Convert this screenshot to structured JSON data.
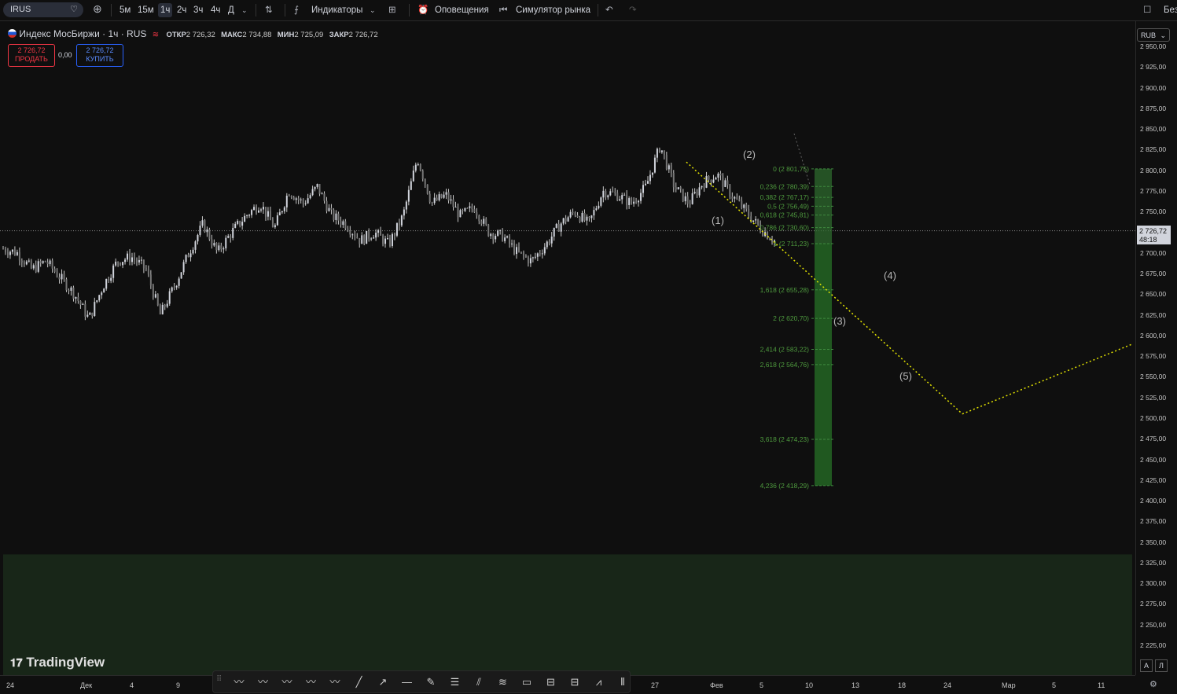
{
  "toolbar": {
    "symbol": "IRUS",
    "intervals": [
      "5м",
      "15м",
      "1ч",
      "2ч",
      "3ч",
      "4ч",
      "Д"
    ],
    "active_interval": "1ч",
    "indicators_label": "Индикаторы",
    "alerts_label": "Оповещения",
    "replay_label": "Симулятор рынка",
    "right_label": "Без"
  },
  "legend": {
    "title": "Индекс МосБиржи · 1ч · RUS",
    "open_label": "ОТКР",
    "open": "2 726,32",
    "high_label": "МАКС",
    "high": "2 734,88",
    "low_label": "МИН",
    "low": "2 725,09",
    "close_label": "ЗАКР",
    "close": "2 726,72"
  },
  "trade": {
    "sell_price": "2 726,72",
    "sell_label": "ПРОДАТЬ",
    "spread": "0,00",
    "buy_price": "2 726,72",
    "buy_label": "КУПИТЬ"
  },
  "currency": "RUB",
  "last_price": {
    "price": "2 726,72",
    "countdown": "48:18"
  },
  "brand": "TradingView",
  "scale_buttons": [
    "A",
    "Л"
  ],
  "colors": {
    "fib_text": "#4e9a3e",
    "zone": "#1e5c1e",
    "projection": "#e6e600",
    "candle": "#d1d4dc"
  },
  "drawing_tools": [
    "wxy-icon",
    "wxyxz-icon",
    "abc-icon",
    "12345-icon",
    "abcde-icon",
    "trendline-icon",
    "ray-icon",
    "horizontal-line-icon",
    "pen-icon",
    "parallel-channel-icon",
    "fib-retracement-icon",
    "fib-extension-icon",
    "rectangle-icon",
    "long-position-icon",
    "short-position-icon",
    "path-icon",
    "date-range-icon"
  ],
  "chart_data": {
    "type": "candlestick",
    "symbol": "Индекс МосБиржи",
    "interval": "1ч",
    "y_ticks": [
      "2 950,00",
      "2 925,00",
      "2 900,00",
      "2 875,00",
      "2 850,00",
      "2 825,00",
      "2 800,00",
      "2 775,00",
      "2 750,00",
      "2 725,00",
      "2 700,00",
      "2 675,00",
      "2 650,00",
      "2 625,00",
      "2 600,00",
      "2 575,00",
      "2 550,00",
      "2 525,00",
      "2 500,00",
      "2 475,00",
      "2 450,00",
      "2 425,00",
      "2 400,00",
      "2 375,00",
      "2 350,00",
      "2 325,00",
      "2 300,00",
      "2 275,00",
      "2 250,00",
      "2 225,00"
    ],
    "ylim": [
      2200,
      2960
    ],
    "x_ticks": [
      "24",
      "Дек",
      "4",
      "9",
      "27",
      "Фев",
      "5",
      "10",
      "13",
      "18",
      "24",
      "Мар",
      "5",
      "11"
    ],
    "price_path": [
      [
        0,
        2705
      ],
      [
        1,
        2700
      ],
      [
        2,
        2680
      ],
      [
        3,
        2690
      ],
      [
        4,
        2670
      ],
      [
        5,
        2650
      ],
      [
        6,
        2620
      ],
      [
        7,
        2660
      ],
      [
        8,
        2690
      ],
      [
        9,
        2695
      ],
      [
        10,
        2680
      ],
      [
        11,
        2625
      ],
      [
        12,
        2660
      ],
      [
        13,
        2700
      ],
      [
        14,
        2735
      ],
      [
        15,
        2700
      ],
      [
        16,
        2725
      ],
      [
        17,
        2745
      ],
      [
        18,
        2760
      ],
      [
        19,
        2730
      ],
      [
        20,
        2775
      ],
      [
        21,
        2760
      ],
      [
        22,
        2780
      ],
      [
        23,
        2745
      ],
      [
        24,
        2735
      ],
      [
        25,
        2715
      ],
      [
        26,
        2725
      ],
      [
        27,
        2710
      ],
      [
        28,
        2745
      ],
      [
        29,
        2815
      ],
      [
        30,
        2760
      ],
      [
        31,
        2770
      ],
      [
        32,
        2745
      ],
      [
        33,
        2755
      ],
      [
        34,
        2725
      ],
      [
        35,
        2720
      ],
      [
        36,
        2700
      ],
      [
        37,
        2690
      ],
      [
        38,
        2710
      ],
      [
        39,
        2735
      ],
      [
        40,
        2750
      ],
      [
        41,
        2735
      ],
      [
        42,
        2775
      ],
      [
        43,
        2770
      ],
      [
        44,
        2760
      ],
      [
        45,
        2780
      ],
      [
        46,
        2830
      ],
      [
        47,
        2780
      ],
      [
        48,
        2760
      ],
      [
        49,
        2785
      ],
      [
        50,
        2795
      ],
      [
        51,
        2770
      ],
      [
        52,
        2750
      ],
      [
        53,
        2730
      ],
      [
        54,
        2715
      ]
    ],
    "fib_levels": [
      {
        "ratio": "0",
        "price": 2801.75,
        "label": "0 (2 801,75)"
      },
      {
        "ratio": "0,236",
        "price": 2780.39,
        "label": "0,236 (2 780,39)"
      },
      {
        "ratio": "0,382",
        "price": 2767.17,
        "label": "0,382 (2 767,17)"
      },
      {
        "ratio": "0,5",
        "price": 2756.49,
        "label": "0,5 (2 756,49)"
      },
      {
        "ratio": "0,618",
        "price": 2745.81,
        "label": "0,618 (2 745,81)"
      },
      {
        "ratio": "0,786",
        "price": 2730.6,
        "label": "0,786 (2 730,60)"
      },
      {
        "ratio": "1",
        "price": 2711.23,
        "label": "1 (2 711,23)"
      },
      {
        "ratio": "1,618",
        "price": 2655.28,
        "label": "1,618 (2 655,28)"
      },
      {
        "ratio": "2",
        "price": 2620.7,
        "label": "2 (2 620,70)"
      },
      {
        "ratio": "2,414",
        "price": 2583.22,
        "label": "2,414 (2 583,22)"
      },
      {
        "ratio": "2,618",
        "price": 2564.76,
        "label": "2,618 (2 564,76)"
      },
      {
        "ratio": "3,618",
        "price": 2474.23,
        "label": "3,618 (2 474,23)"
      },
      {
        "ratio": "4,236",
        "price": 2418.29,
        "label": "4,236 (2 418,29)"
      }
    ],
    "wave_labels": [
      "(1)",
      "(2)",
      "(3)",
      "(4)",
      "(5)"
    ],
    "projection": {
      "start_price": 2810,
      "wave5_low": 2505,
      "end_price": 2590
    },
    "support_zone": {
      "from": 2200,
      "to": 2335
    }
  }
}
